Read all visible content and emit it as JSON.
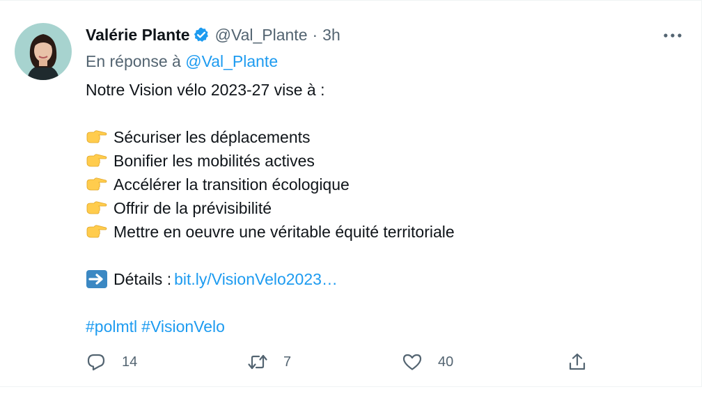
{
  "tweet": {
    "author": {
      "display_name": "Valérie Plante",
      "handle": "@Val_Plante",
      "separator": "·",
      "time": "3h",
      "avatar_icon": "profile-photo"
    },
    "reply_prefix": "En réponse à",
    "reply_handle": "@Val_Plante",
    "body": {
      "intro": "Notre Vision vélo 2023-27 vise à :",
      "points": [
        "Sécuriser les déplacements",
        "Bonifier les mobilités actives",
        "Accélérer la transition écologique",
        "Offrir de la prévisibilité",
        "Mettre en oeuvre une véritable équité territoriale"
      ],
      "point_icon": "pointing-right-hand-emoji",
      "details_icon": "right-arrow-emoji",
      "details_label": "Détails :",
      "details_link": "bit.ly/VisionVelo2023…",
      "hashtags": [
        "#polmtl",
        "#VisionVelo"
      ]
    },
    "actions": {
      "reply_count": "14",
      "retweet_count": "7",
      "like_count": "40"
    },
    "colors": {
      "link": "#1d9bf0",
      "muted": "#536471",
      "text": "#0f1419",
      "verified": "#1d9bf0"
    }
  }
}
